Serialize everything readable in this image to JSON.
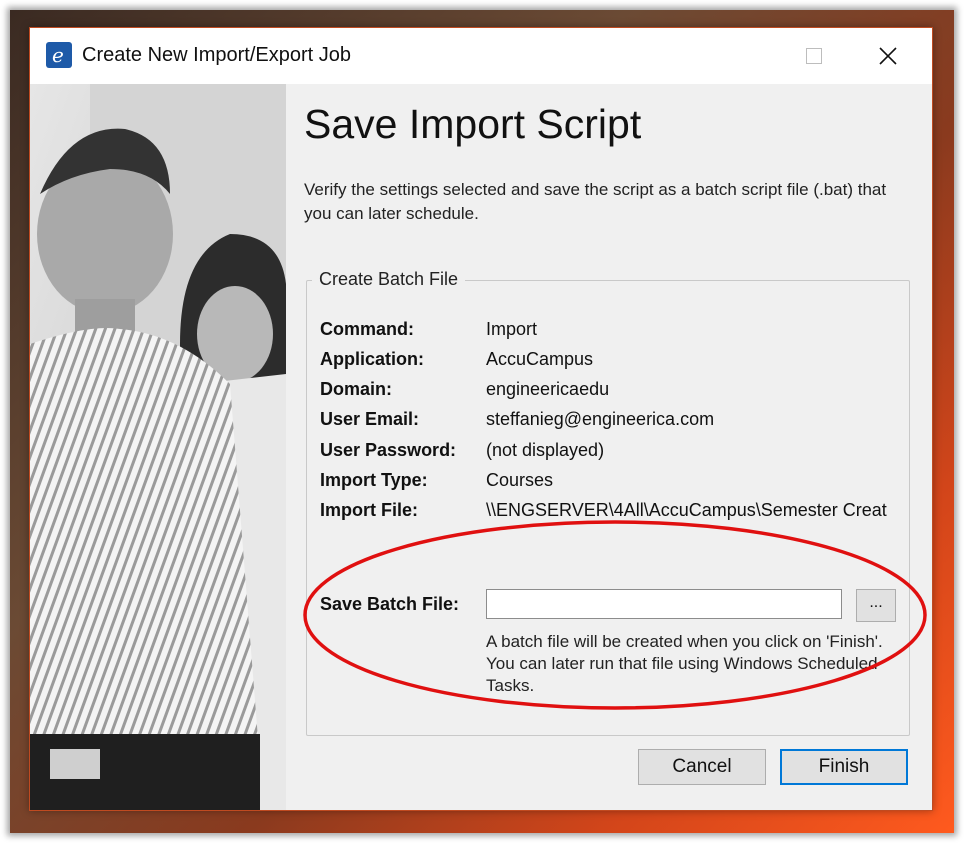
{
  "window": {
    "title": "Create New Import/Export Job",
    "app_icon": "engineerica-e-icon",
    "controls": [
      "minimize-icon",
      "maximize-icon",
      "close-icon"
    ]
  },
  "main": {
    "heading": "Save Import Script",
    "description": "Verify the settings selected and save the script as a batch script file (.bat) that you can later schedule."
  },
  "group": {
    "title": "Create Batch File",
    "rows": [
      {
        "label": "Command:",
        "value": "Import"
      },
      {
        "label": "Application:",
        "value": "AccuCampus"
      },
      {
        "label": "Domain:",
        "value": "engineericaedu"
      },
      {
        "label": "User Email:",
        "value": "steffanieg@engineerica.com"
      },
      {
        "label": "User Password:",
        "value": "(not displayed)"
      },
      {
        "label": "Import Type:",
        "value": "Courses"
      },
      {
        "label": "Import File:",
        "value": "\\\\ENGSERVER\\4All\\AccuCampus\\Semester Creat"
      }
    ],
    "save_label": "Save Batch File:",
    "save_value": "",
    "browse_label": "...",
    "hint": "A batch file will be created when you click on 'Finish'. You can later run that file using Windows Scheduled Tasks."
  },
  "buttons": {
    "cancel": "Cancel",
    "finish": "Finish"
  },
  "colors": {
    "annotation": "#e01010",
    "accent": "#0078d7",
    "app_icon": "#1e5aa8"
  }
}
